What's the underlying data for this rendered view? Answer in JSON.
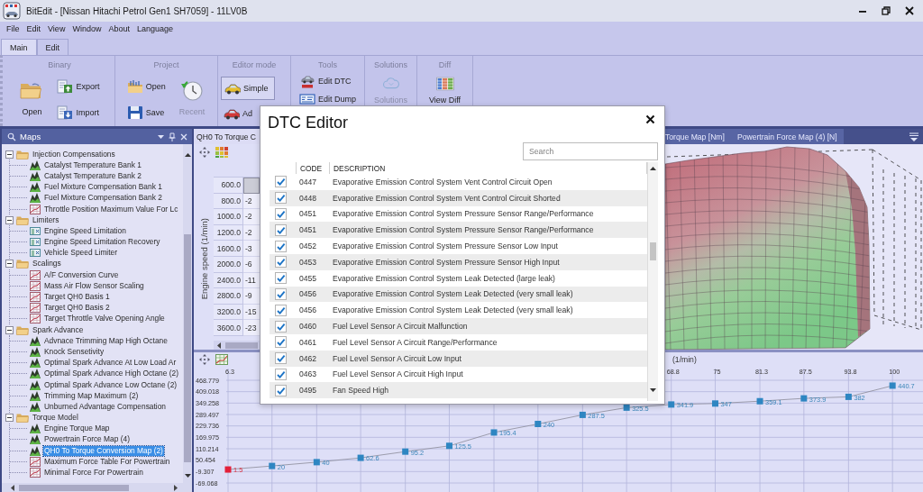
{
  "window": {
    "title": "BitEdit - [Nissan Hitachi Petrol Gen1 SH7059] - 11LV0B"
  },
  "menu": [
    "File",
    "Edit",
    "View",
    "Window",
    "About",
    "Language"
  ],
  "ribbon": {
    "tabs": [
      {
        "label": "Main",
        "selected": true
      },
      {
        "label": "Edit",
        "selected": false
      }
    ],
    "groups": [
      {
        "title": "Binary",
        "buttons": [
          {
            "label": "Open",
            "kind": "large",
            "disabled": false
          },
          {
            "label": "Export",
            "kind": "small",
            "disabled": false
          },
          {
            "label": "Import",
            "kind": "small",
            "disabled": false
          }
        ]
      },
      {
        "title": "Project",
        "buttons": [
          {
            "label": "Open",
            "kind": "small",
            "disabled": false
          },
          {
            "label": "Save",
            "kind": "small",
            "disabled": false
          },
          {
            "label": "Recent",
            "kind": "large",
            "disabled": true
          }
        ]
      },
      {
        "title": "Editor mode",
        "buttons": [
          {
            "label": "Simple",
            "kind": "small",
            "disabled": false,
            "selected": true
          },
          {
            "label": "Ad",
            "kind": "small",
            "disabled": false,
            "selected": false
          }
        ]
      },
      {
        "title": "Tools",
        "buttons": [
          {
            "label": "Edit DTC",
            "kind": "small",
            "disabled": false
          },
          {
            "label": "Edit Dump",
            "kind": "small",
            "disabled": false
          }
        ]
      },
      {
        "title": "Solutions",
        "buttons": [
          {
            "label": "Solutions",
            "kind": "large",
            "disabled": true
          }
        ]
      },
      {
        "title": "Diff",
        "buttons": [
          {
            "label": "View Diff",
            "kind": "large",
            "disabled": false
          }
        ]
      }
    ]
  },
  "maps_panel": {
    "title": "Maps",
    "tree": [
      {
        "label": "Injection Compensations",
        "expanded": true,
        "selected": false,
        "children": [
          {
            "label": "Catalyst Temperature Bank 1",
            "kind": "map3d",
            "selected": false
          },
          {
            "label": "Catalyst Temperature Bank 2",
            "kind": "map3d",
            "selected": false
          },
          {
            "label": "Fuel Mixture Compensation Bank 1",
            "kind": "map3d",
            "selected": false
          },
          {
            "label": "Fuel Mixture Compensation Bank 2",
            "kind": "map3d",
            "selected": false
          },
          {
            "label": "Throttle Position Maximum Value For Lc",
            "kind": "curve",
            "selected": false
          }
        ]
      },
      {
        "label": "Limiters",
        "expanded": true,
        "selected": false,
        "children": [
          {
            "label": "Engine Speed Limitation",
            "kind": "value",
            "selected": false
          },
          {
            "label": "Engine Speed Limitation Recovery",
            "kind": "value",
            "selected": false
          },
          {
            "label": "Vehicle Speed Limiter",
            "kind": "value",
            "selected": false
          }
        ]
      },
      {
        "label": "Scalings",
        "expanded": true,
        "selected": false,
        "children": [
          {
            "label": "A/F Conversion Curve",
            "kind": "curve",
            "selected": false
          },
          {
            "label": "Mass Air Flow Sensor Scaling",
            "kind": "curve",
            "selected": false
          },
          {
            "label": "Target QH0 Basis 1",
            "kind": "curve",
            "selected": false
          },
          {
            "label": "Target QH0 Basis 2",
            "kind": "curve",
            "selected": false
          },
          {
            "label": "Target Throttle Valve Opening Angle",
            "kind": "curve",
            "selected": false
          }
        ]
      },
      {
        "label": "Spark Advance",
        "expanded": true,
        "selected": false,
        "children": [
          {
            "label": "Advnace Trimming Map High Octane",
            "kind": "map3d",
            "selected": false
          },
          {
            "label": "Knock Sensetivity",
            "kind": "map3d",
            "selected": false
          },
          {
            "label": "Optimal Spark Advance At Low Load Ar",
            "kind": "map3d",
            "selected": false
          },
          {
            "label": "Optimal Spark Advance High Octane (2)",
            "kind": "map3d",
            "selected": false
          },
          {
            "label": "Optimal Spark Advance Low Octane (2)",
            "kind": "map3d",
            "selected": false
          },
          {
            "label": "Trimming Map Maximum (2)",
            "kind": "map3d",
            "selected": false
          },
          {
            "label": "Unburned Advantage Compensation",
            "kind": "map3d",
            "selected": false
          }
        ]
      },
      {
        "label": "Torque Model",
        "expanded": true,
        "selected": false,
        "children": [
          {
            "label": "Engine Torque Map",
            "kind": "map3d",
            "selected": false
          },
          {
            "label": "Powertrain Force Map (4)",
            "kind": "map3d",
            "selected": false
          },
          {
            "label": "QH0 To Torque Conversion Map (2)",
            "kind": "map3d",
            "selected": true
          },
          {
            "label": "Maximum Force Table For Powertrain",
            "kind": "curve",
            "selected": false
          },
          {
            "label": "Minimal Force For Powertrain",
            "kind": "curve",
            "selected": false
          }
        ]
      }
    ]
  },
  "documents": {
    "tabs": [
      {
        "label": "QH0 To Torque C",
        "selected": true
      },
      {
        "label": "Torque Map [Nm]",
        "selected": false
      },
      {
        "label": "Powertrain Force Map (4) [N]",
        "selected": false
      }
    ],
    "map_view": {
      "axis_title": "Engine speed (1/min)",
      "rows": [
        {
          "label": "600.0",
          "selected": true
        },
        {
          "label": "800.0",
          "value": "-2",
          "selected": false
        },
        {
          "label": "1000.0",
          "value": "-2",
          "selected": false
        },
        {
          "label": "1200.0",
          "value": "-2",
          "selected": false
        },
        {
          "label": "1600.0",
          "value": "-3",
          "selected": false
        },
        {
          "label": "2000.0",
          "value": "-6",
          "selected": false
        },
        {
          "label": "2400.0",
          "value": "-11",
          "selected": false
        },
        {
          "label": "2800.0",
          "value": "-9",
          "selected": false
        },
        {
          "label": "3200.0",
          "value": "-15",
          "selected": false
        },
        {
          "label": "3600.0",
          "value": "-23",
          "selected": false
        }
      ]
    },
    "curve_view": {
      "chart_data": {
        "type": "line",
        "xlabel": "(1/min)",
        "x": [
          6.3,
          12.5,
          18.8,
          25,
          31.3,
          37.5,
          43.8,
          50,
          56.3,
          62.5,
          68.8,
          75,
          81.3,
          87.5,
          93.8,
          100
        ],
        "values": [
          1.5,
          20,
          40,
          62.6,
          95.2,
          125.5,
          195.4,
          240,
          287.5,
          325.5,
          341.9,
          347,
          359.1,
          373.9,
          382,
          440.7
        ],
        "xlim": [
          6.3,
          104.3
        ],
        "ylim": [
          -69.068,
          468.779
        ],
        "xticks": [
          6.3,
          68.8,
          75,
          81.3,
          87.5,
          93.8,
          100
        ],
        "yticks": [
          468.779,
          409.018,
          349.258,
          289.497,
          229.736,
          169.975,
          110.214,
          50.454,
          -9.307,
          -69.068
        ],
        "grid": true,
        "marker": "square",
        "data_labels": true
      },
      "points": [
        {
          "selected": true
        },
        {
          "selected": false
        },
        {
          "selected": false
        },
        {
          "selected": false
        },
        {
          "selected": false
        },
        {
          "selected": false
        },
        {
          "selected": false
        },
        {
          "selected": false
        },
        {
          "selected": false
        },
        {
          "selected": false
        },
        {
          "selected": false
        },
        {
          "selected": false
        },
        {
          "selected": false
        },
        {
          "selected": false
        },
        {
          "selected": false
        },
        {
          "selected": false
        }
      ]
    }
  },
  "dtc_editor": {
    "title": "DTC Editor",
    "search": {
      "placeholder": "Search"
    },
    "columns": [
      "CODE",
      "DESCRIPTION"
    ],
    "rows": [
      {
        "checked": true,
        "code": "0447",
        "description": "Evaporative Emission Control System Vent Control Circuit Open"
      },
      {
        "checked": true,
        "code": "0448",
        "description": "Evaporative Emission Control System Vent Control Circuit Shorted"
      },
      {
        "checked": true,
        "code": "0451",
        "description": "Evaporative Emission Control System Pressure Sensor Range/Performance"
      },
      {
        "checked": true,
        "code": "0451",
        "description": "Evaporative Emission Control System Pressure Sensor Range/Performance"
      },
      {
        "checked": true,
        "code": "0452",
        "description": "Evaporative Emission Control System Pressure Sensor Low Input"
      },
      {
        "checked": true,
        "code": "0453",
        "description": "Evaporative Emission Control System Pressure Sensor High Input"
      },
      {
        "checked": true,
        "code": "0455",
        "description": "Evaporative Emission Control System Leak Detected (large leak)"
      },
      {
        "checked": true,
        "code": "0456",
        "description": "Evaporative Emission Control System Leak Detected (very small leak)"
      },
      {
        "checked": true,
        "code": "0456",
        "description": "Evaporative Emission Control System Leak Detected (very small leak)"
      },
      {
        "checked": true,
        "code": "0460",
        "description": "Fuel Level Sensor A Circuit Malfunction"
      },
      {
        "checked": true,
        "code": "0461",
        "description": "Fuel Level Sensor A Circuit Range/Performance"
      },
      {
        "checked": true,
        "code": "0462",
        "description": "Fuel Level Sensor A Circuit Low Input"
      },
      {
        "checked": true,
        "code": "0463",
        "description": "Fuel Level Sensor A Circuit High Input"
      },
      {
        "checked": true,
        "code": "0495",
        "description": "Fan Speed High"
      }
    ]
  }
}
